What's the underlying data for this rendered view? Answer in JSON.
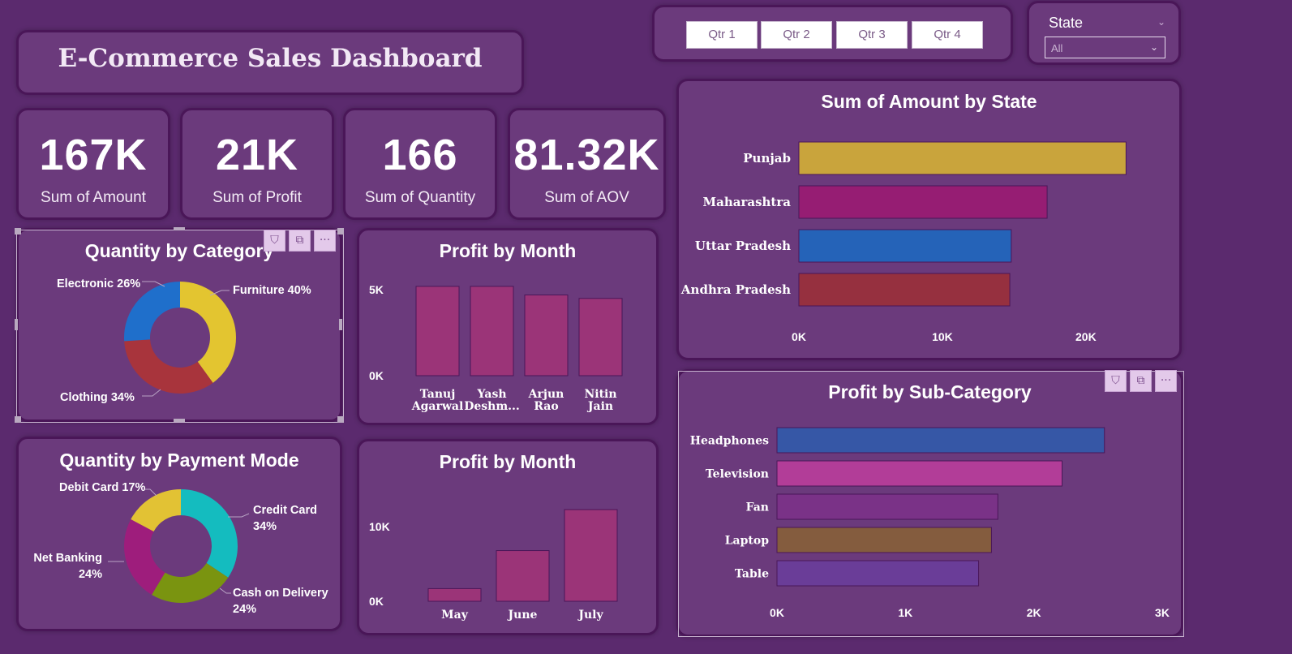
{
  "header": {
    "title": "E-Commerce Sales Dashboard"
  },
  "kpis": [
    {
      "value": "167K",
      "label": "Sum of Amount"
    },
    {
      "value": "21K",
      "label": "Sum of Profit"
    },
    {
      "value": "166",
      "label": "Sum of Quantity"
    },
    {
      "value": "81.32K",
      "label": "Sum of AOV"
    }
  ],
  "quarter_slicer": {
    "buttons": [
      "Qtr 1",
      "Qtr 2",
      "Qtr 3",
      "Qtr 4"
    ]
  },
  "state_slicer": {
    "label": "State",
    "selected": "All"
  },
  "visual_tools": {
    "filter": "⛉",
    "focus": "⧉",
    "more": "···"
  },
  "colors": {
    "background": "#5b2a6e",
    "card": "#6b3a7c",
    "bar_magenta": "#9b3478"
  },
  "chart_data": [
    {
      "id": "amount_by_state",
      "type": "bar",
      "orientation": "horizontal",
      "title": "Sum of Amount by State",
      "categories": [
        "Punjab",
        "Maharashtra",
        "Uttar Pradesh",
        "Andhra Pradesh"
      ],
      "values": [
        22800,
        17300,
        14800,
        14700
      ],
      "colors": [
        "#c9a43c",
        "#961d73",
        "#2563b8",
        "#96303f"
      ],
      "ticks": [
        "0K",
        "10K",
        "20K"
      ],
      "xlim": [
        0,
        26000
      ]
    },
    {
      "id": "profit_by_subcategory",
      "type": "bar",
      "orientation": "horizontal",
      "title": "Profit by Sub-Category",
      "categories": [
        "Headphones",
        "Television",
        "Fan",
        "Laptop",
        "Table"
      ],
      "values": [
        2550,
        2220,
        1720,
        1670,
        1570
      ],
      "colors": [
        "#3657a6",
        "#b23d98",
        "#7a3287",
        "#845c3e",
        "#6a3d98"
      ],
      "ticks": [
        "0K",
        "1K",
        "2K",
        "3K"
      ],
      "xlim": [
        0,
        3000
      ]
    },
    {
      "id": "profit_by_customer",
      "type": "bar",
      "title": "Profit by Month",
      "categories": [
        "Tanuj Agarwal",
        "Yash Deshm...",
        "Arjun Rao",
        "Nitin Jain"
      ],
      "tick_lines": [
        [
          "Tanuj",
          "Agarwal"
        ],
        [
          "Yash",
          "Deshm..."
        ],
        [
          "Arjun",
          "Rao"
        ],
        [
          "Nitin",
          "Jain"
        ]
      ],
      "values": [
        5200,
        5200,
        4700,
        4500
      ],
      "ticks": [
        "0K",
        "5K"
      ],
      "ylim": [
        0,
        6000
      ]
    },
    {
      "id": "profit_by_month",
      "type": "bar",
      "title": "Profit by Month",
      "categories": [
        "May",
        "June",
        "July"
      ],
      "values": [
        1700,
        6800,
        12300
      ],
      "ticks": [
        "0K",
        "10K"
      ],
      "ylim": [
        0,
        13500
      ]
    },
    {
      "id": "quantity_by_category",
      "type": "pie",
      "donut": true,
      "title": "Quantity by Category",
      "labels": [
        "Furniture 40%",
        "Clothing 34%",
        "Electronic 26%"
      ],
      "values": [
        40,
        34,
        26
      ],
      "colors": [
        "#e3c530",
        "#a8343c",
        "#1f6fcb"
      ]
    },
    {
      "id": "quantity_by_payment_mode",
      "type": "pie",
      "donut": true,
      "title": "Quantity by Payment Mode",
      "labels": [
        [
          "Credit Card",
          "34%"
        ],
        [
          "Cash on Delivery",
          "24%"
        ],
        [
          "Net Banking",
          "24%"
        ],
        [
          "Debit Card 17%"
        ]
      ],
      "values": [
        34,
        24,
        24,
        17
      ],
      "colors": [
        "#14bcbf",
        "#7a9410",
        "#9e1d7c",
        "#e2c234"
      ]
    }
  ]
}
